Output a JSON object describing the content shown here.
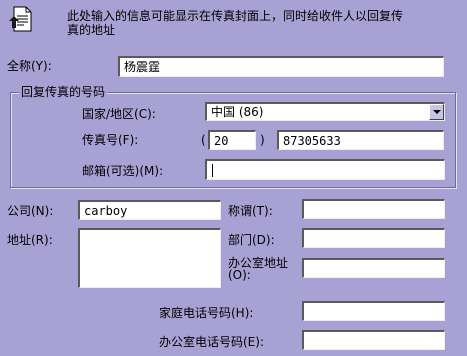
{
  "info": {
    "line1": "此处输入的信息可能显示在传真封面上，同时给收件人以回复传",
    "line2": "真的地址"
  },
  "fields": {
    "full_name_label": "全称(Y):",
    "full_name_value": "杨震霆",
    "reply_group_label": "回复传真的号码",
    "country_label": "国家/地区(C):",
    "country_value": "中国 (86)",
    "fax_label": "传真号(F):",
    "fax_area_code": "20",
    "fax_number": "87305633",
    "mailbox_label": "邮箱(可选)(M):",
    "mailbox_value": "",
    "company_label": "公司(N):",
    "company_value": "carboy",
    "title_label": "称谓(T):",
    "title_value": "",
    "address_label": "地址(R):",
    "address_value": "",
    "department_label": "部门(D):",
    "department_value": "",
    "office_label_line1": "办公室地址",
    "office_label_line2": "(O):",
    "office_value": "",
    "home_phone_label": "家庭电话号码(H):",
    "home_phone_value": "",
    "office_phone_label": "办公室电话号码(E):",
    "office_phone_value": ""
  },
  "symbols": {
    "paren_open": "(",
    "paren_close": ")"
  },
  "icons": {
    "header": "fax-cover-info-icon"
  }
}
